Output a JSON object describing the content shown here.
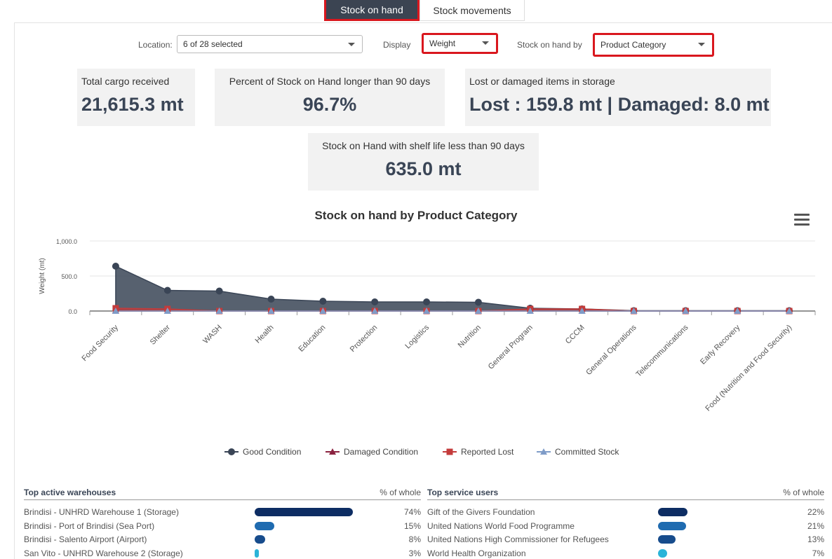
{
  "tabs": [
    {
      "label": "Stock on hand",
      "active": true
    },
    {
      "label": "Stock movements",
      "active": false
    }
  ],
  "filters": {
    "location_label": "Location:",
    "location_value": "6 of 28 selected",
    "display_label": "Display",
    "display_value": "Weight",
    "group_label": "Stock on hand by",
    "group_value": "Product Category"
  },
  "kpis": {
    "total_cargo": {
      "label": "Total cargo received",
      "value": "21,615.3 mt"
    },
    "over_90": {
      "label": "Percent of Stock on Hand longer than 90 days",
      "value": "96.7%"
    },
    "lost_damaged": {
      "label": "Lost or damaged items in storage",
      "value": "Lost : 159.8 mt | Damaged: 8.0 mt"
    },
    "shelf_life": {
      "label": "Stock on Hand with shelf life less than 90 days",
      "value": "635.0 mt"
    }
  },
  "chart_data": {
    "type": "area",
    "title": "Stock on hand by Product Category",
    "xlabel": "",
    "ylabel": "Weight (mt)",
    "ylim": [
      0,
      1000
    ],
    "yticks": [
      "0.0",
      "500.0",
      "1,000.0"
    ],
    "categories": [
      "Food Security",
      "Shelter",
      "WASH",
      "Health",
      "Education",
      "Protection",
      "Logistics",
      "Nutrition",
      "General Program",
      "CCCM",
      "General Operations",
      "Telecommunications",
      "Early Recovery",
      "Food (Nutrition and Food Security)"
    ],
    "series": [
      {
        "name": "Good Condition",
        "color": "#3a4556",
        "values": [
          640,
          295,
          285,
          170,
          140,
          130,
          130,
          125,
          40,
          30,
          5,
          5,
          5,
          5
        ]
      },
      {
        "name": "Damaged Condition",
        "color": "#8b2340",
        "values": [
          8,
          0,
          0,
          0,
          0,
          0,
          0,
          0,
          0,
          0,
          0,
          0,
          0,
          0
        ]
      },
      {
        "name": "Reported Lost",
        "color": "#c43b3b",
        "values": [
          40,
          30,
          0,
          0,
          0,
          0,
          0,
          0,
          30,
          30,
          0,
          0,
          0,
          0
        ]
      },
      {
        "name": "Committed Stock",
        "color": "#7f9cc8",
        "values": [
          0,
          0,
          0,
          0,
          0,
          0,
          0,
          0,
          0,
          0,
          0,
          0,
          0,
          0
        ]
      }
    ],
    "grid": true,
    "legend": "bottom-center"
  },
  "warehouses": {
    "title": "Top active warehouses",
    "pct_header": "% of whole",
    "rows": [
      {
        "name": "Brindisi - UNHRD Warehouse 1 (Storage)",
        "pct": "74%",
        "value": 74,
        "color": "#0d2d63"
      },
      {
        "name": "Brindisi - Port of Brindisi (Sea Port)",
        "pct": "15%",
        "value": 15,
        "color": "#1f6bb0"
      },
      {
        "name": "Brindisi - Salento Airport (Airport)",
        "pct": "8%",
        "value": 8,
        "color": "#174c8c"
      },
      {
        "name": "San Vito - UNHRD Warehouse 2 (Storage)",
        "pct": "3%",
        "value": 3,
        "color": "#2bb4d8"
      }
    ]
  },
  "service_users": {
    "title": "Top service users",
    "pct_header": "% of whole",
    "rows": [
      {
        "name": "Gift of the Givers Foundation",
        "pct": "22%",
        "value": 22,
        "color": "#0d2d63"
      },
      {
        "name": "United Nations World Food Programme",
        "pct": "21%",
        "value": 21,
        "color": "#1f6bb0"
      },
      {
        "name": "United Nations High Commissioner for Refugees",
        "pct": "13%",
        "value": 13,
        "color": "#174c8c"
      },
      {
        "name": "World Health Organization",
        "pct": "7%",
        "value": 7,
        "color": "#2bb4d8"
      }
    ]
  }
}
